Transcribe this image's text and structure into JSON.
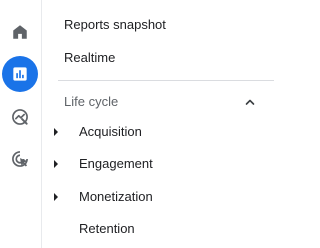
{
  "rail": {
    "items": [
      {
        "icon": "home-icon",
        "active": false
      },
      {
        "icon": "reports-icon",
        "active": true
      },
      {
        "icon": "explore-icon",
        "active": false
      },
      {
        "icon": "advertising-icon",
        "active": false
      }
    ],
    "active_color": "#1a73e8"
  },
  "nav": {
    "top_items": [
      {
        "label": "Reports snapshot"
      },
      {
        "label": "Realtime"
      }
    ],
    "section": {
      "title": "Life cycle",
      "expanded": true,
      "items": [
        {
          "label": "Acquisition",
          "expandable": true
        },
        {
          "label": "Engagement",
          "expandable": true
        },
        {
          "label": "Monetization",
          "expandable": true
        },
        {
          "label": "Retention",
          "expandable": false
        }
      ]
    }
  }
}
